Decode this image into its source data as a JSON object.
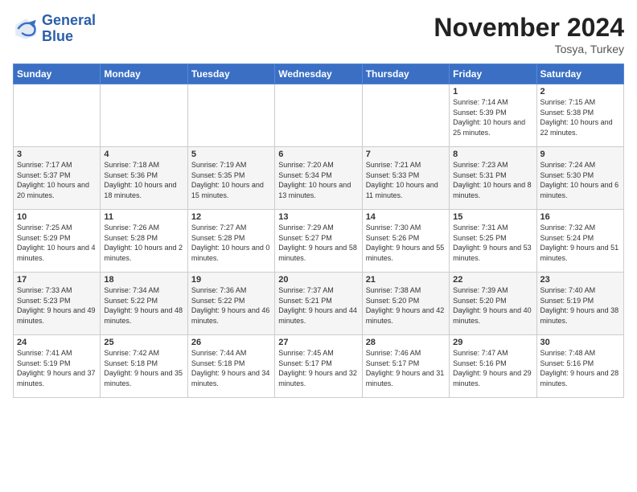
{
  "header": {
    "logo_line1": "General",
    "logo_line2": "Blue",
    "month": "November 2024",
    "location": "Tosya, Turkey"
  },
  "days_of_week": [
    "Sunday",
    "Monday",
    "Tuesday",
    "Wednesday",
    "Thursday",
    "Friday",
    "Saturday"
  ],
  "weeks": [
    [
      {
        "day": "",
        "info": ""
      },
      {
        "day": "",
        "info": ""
      },
      {
        "day": "",
        "info": ""
      },
      {
        "day": "",
        "info": ""
      },
      {
        "day": "",
        "info": ""
      },
      {
        "day": "1",
        "info": "Sunrise: 7:14 AM\nSunset: 5:39 PM\nDaylight: 10 hours and 25 minutes."
      },
      {
        "day": "2",
        "info": "Sunrise: 7:15 AM\nSunset: 5:38 PM\nDaylight: 10 hours and 22 minutes."
      }
    ],
    [
      {
        "day": "3",
        "info": "Sunrise: 7:17 AM\nSunset: 5:37 PM\nDaylight: 10 hours and 20 minutes."
      },
      {
        "day": "4",
        "info": "Sunrise: 7:18 AM\nSunset: 5:36 PM\nDaylight: 10 hours and 18 minutes."
      },
      {
        "day": "5",
        "info": "Sunrise: 7:19 AM\nSunset: 5:35 PM\nDaylight: 10 hours and 15 minutes."
      },
      {
        "day": "6",
        "info": "Sunrise: 7:20 AM\nSunset: 5:34 PM\nDaylight: 10 hours and 13 minutes."
      },
      {
        "day": "7",
        "info": "Sunrise: 7:21 AM\nSunset: 5:33 PM\nDaylight: 10 hours and 11 minutes."
      },
      {
        "day": "8",
        "info": "Sunrise: 7:23 AM\nSunset: 5:31 PM\nDaylight: 10 hours and 8 minutes."
      },
      {
        "day": "9",
        "info": "Sunrise: 7:24 AM\nSunset: 5:30 PM\nDaylight: 10 hours and 6 minutes."
      }
    ],
    [
      {
        "day": "10",
        "info": "Sunrise: 7:25 AM\nSunset: 5:29 PM\nDaylight: 10 hours and 4 minutes."
      },
      {
        "day": "11",
        "info": "Sunrise: 7:26 AM\nSunset: 5:28 PM\nDaylight: 10 hours and 2 minutes."
      },
      {
        "day": "12",
        "info": "Sunrise: 7:27 AM\nSunset: 5:28 PM\nDaylight: 10 hours and 0 minutes."
      },
      {
        "day": "13",
        "info": "Sunrise: 7:29 AM\nSunset: 5:27 PM\nDaylight: 9 hours and 58 minutes."
      },
      {
        "day": "14",
        "info": "Sunrise: 7:30 AM\nSunset: 5:26 PM\nDaylight: 9 hours and 55 minutes."
      },
      {
        "day": "15",
        "info": "Sunrise: 7:31 AM\nSunset: 5:25 PM\nDaylight: 9 hours and 53 minutes."
      },
      {
        "day": "16",
        "info": "Sunrise: 7:32 AM\nSunset: 5:24 PM\nDaylight: 9 hours and 51 minutes."
      }
    ],
    [
      {
        "day": "17",
        "info": "Sunrise: 7:33 AM\nSunset: 5:23 PM\nDaylight: 9 hours and 49 minutes."
      },
      {
        "day": "18",
        "info": "Sunrise: 7:34 AM\nSunset: 5:22 PM\nDaylight: 9 hours and 48 minutes."
      },
      {
        "day": "19",
        "info": "Sunrise: 7:36 AM\nSunset: 5:22 PM\nDaylight: 9 hours and 46 minutes."
      },
      {
        "day": "20",
        "info": "Sunrise: 7:37 AM\nSunset: 5:21 PM\nDaylight: 9 hours and 44 minutes."
      },
      {
        "day": "21",
        "info": "Sunrise: 7:38 AM\nSunset: 5:20 PM\nDaylight: 9 hours and 42 minutes."
      },
      {
        "day": "22",
        "info": "Sunrise: 7:39 AM\nSunset: 5:20 PM\nDaylight: 9 hours and 40 minutes."
      },
      {
        "day": "23",
        "info": "Sunrise: 7:40 AM\nSunset: 5:19 PM\nDaylight: 9 hours and 38 minutes."
      }
    ],
    [
      {
        "day": "24",
        "info": "Sunrise: 7:41 AM\nSunset: 5:19 PM\nDaylight: 9 hours and 37 minutes."
      },
      {
        "day": "25",
        "info": "Sunrise: 7:42 AM\nSunset: 5:18 PM\nDaylight: 9 hours and 35 minutes."
      },
      {
        "day": "26",
        "info": "Sunrise: 7:44 AM\nSunset: 5:18 PM\nDaylight: 9 hours and 34 minutes."
      },
      {
        "day": "27",
        "info": "Sunrise: 7:45 AM\nSunset: 5:17 PM\nDaylight: 9 hours and 32 minutes."
      },
      {
        "day": "28",
        "info": "Sunrise: 7:46 AM\nSunset: 5:17 PM\nDaylight: 9 hours and 31 minutes."
      },
      {
        "day": "29",
        "info": "Sunrise: 7:47 AM\nSunset: 5:16 PM\nDaylight: 9 hours and 29 minutes."
      },
      {
        "day": "30",
        "info": "Sunrise: 7:48 AM\nSunset: 5:16 PM\nDaylight: 9 hours and 28 minutes."
      }
    ]
  ]
}
